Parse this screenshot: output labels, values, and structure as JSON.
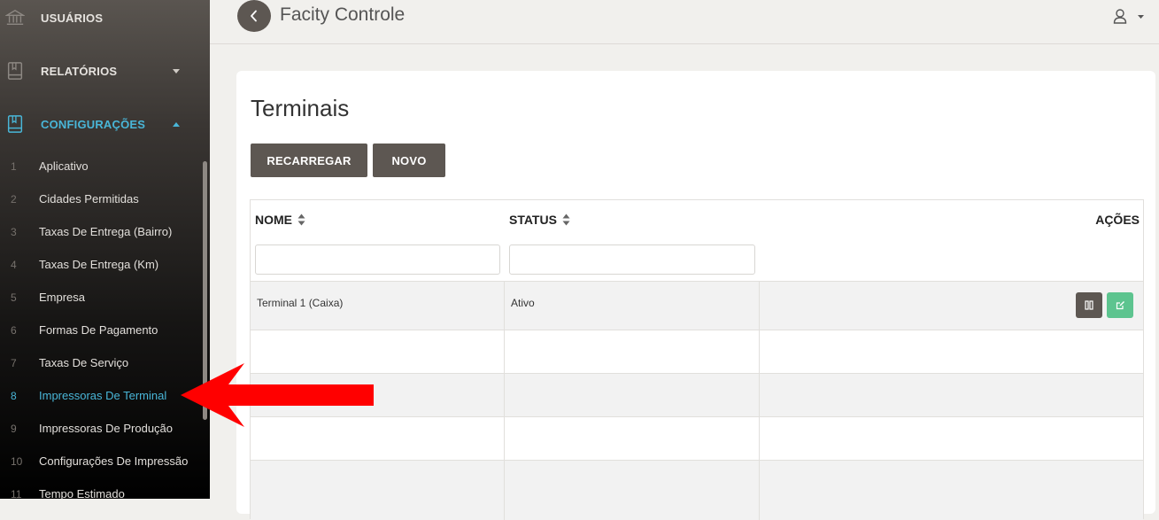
{
  "sidebar": {
    "sections": [
      {
        "label": "USUÁRIOS",
        "icon": "bank-icon"
      },
      {
        "label": "RELATÓRIOS",
        "icon": "book-icon"
      },
      {
        "label": "CONFIGURAÇÕES",
        "icon": "bookmark-book-icon"
      }
    ],
    "items": [
      {
        "num": "1",
        "label": "Aplicativo"
      },
      {
        "num": "2",
        "label": "Cidades Permitidas"
      },
      {
        "num": "3",
        "label": "Taxas De Entrega (Bairro)"
      },
      {
        "num": "4",
        "label": "Taxas De Entrega (Km)"
      },
      {
        "num": "5",
        "label": "Empresa"
      },
      {
        "num": "6",
        "label": "Formas De Pagamento"
      },
      {
        "num": "7",
        "label": "Taxas De Serviço"
      },
      {
        "num": "8",
        "label": "Impressoras De Terminal"
      },
      {
        "num": "9",
        "label": "Impressoras De Produção"
      },
      {
        "num": "10",
        "label": "Configurações De Impressão"
      },
      {
        "num": "11",
        "label": "Tempo Estimado"
      }
    ],
    "active_item": "Impressoras De Terminal"
  },
  "header": {
    "title": "Facity Controle"
  },
  "page": {
    "title": "Terminais",
    "buttons": {
      "reload": "RECARREGAR",
      "new": "NOVO"
    }
  },
  "table": {
    "columns": [
      "NOME",
      "STATUS",
      "AÇÕES"
    ],
    "filters": {
      "name": "",
      "status": ""
    },
    "rows": [
      {
        "name": "Terminal 1 (Caixa)",
        "status": "Ativo"
      }
    ]
  },
  "colors": {
    "accent": "#49b6d8",
    "button": "#5d5752",
    "edit_button": "#5dc48f",
    "annotation_arrow": "#ff0000"
  }
}
